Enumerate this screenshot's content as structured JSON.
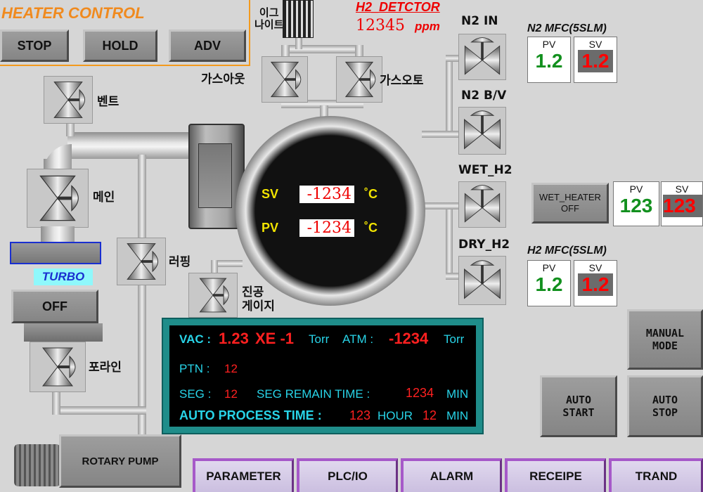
{
  "heater": {
    "title": "HEATER CONTROL",
    "stop": "STOP",
    "hold": "HOLD",
    "adv": "ADV"
  },
  "igniter_label": "이그\n나이트",
  "h2_detector": {
    "title": "H2_DETCTOR",
    "value": "12345",
    "unit": "ppm"
  },
  "valves": {
    "gas_out_left": "가스아웃",
    "gas_out_right": "가스오토",
    "vent": "벤트",
    "main": "메인",
    "roughing": "러핑",
    "vacuum_gauge": "진공\n게이지",
    "foreline": "포라인",
    "n2_in": "N2 IN",
    "n2_bv": "N2 B/V",
    "wet_h2": "WET_H2",
    "dry_h2": "DRY_H2"
  },
  "turbo": {
    "label": "TURBO",
    "state": "OFF"
  },
  "rotary_pump": "ROTARY PUMP",
  "chamber": {
    "sv_label": "SV",
    "sv_value": "-1234",
    "pv_label": "PV",
    "pv_value": "-1234",
    "unit": "˚C"
  },
  "n2_mfc": {
    "title": "N2 MFC(5SLM)",
    "pv_caption": "PV",
    "pv": "1.2",
    "sv_caption": "SV",
    "sv": "1.2"
  },
  "wet_heater": {
    "button": "WET_HEATER\nOFF",
    "pv_caption": "PV",
    "pv": "123",
    "sv_caption": "SV",
    "sv": "123"
  },
  "h2_mfc": {
    "title": "H2 MFC(5SLM)",
    "pv_caption": "PV",
    "pv": "1.2",
    "sv_caption": "SV",
    "sv": "1.2"
  },
  "status": {
    "vac_label": "VAC :",
    "vac_value": "1.23",
    "vac_exp": "XE -1",
    "vac_unit": "Torr",
    "atm_label": "ATM :",
    "atm_value": "-1234",
    "atm_unit": "Torr",
    "ptn_label": "PTN :",
    "ptn_value": "12",
    "seg_label": "SEG :",
    "seg_value": "12",
    "seg_remain_label": "SEG REMAIN TIME :",
    "seg_remain_value": "1234",
    "seg_remain_unit": "MIN",
    "auto_label": "AUTO PROCESS TIME :",
    "auto_hour": "123",
    "auto_hour_unit": "HOUR",
    "auto_min": "12",
    "auto_min_unit": "MIN"
  },
  "buttons": {
    "manual_mode": "MANUAL\nMODE",
    "auto_start": "AUTO\nSTART",
    "auto_stop": "AUTO\nSTOP"
  },
  "nav": [
    "PARAMETER",
    "PLC/IO",
    "ALARM",
    "RECEIPE",
    "TRAND"
  ],
  "colors": {
    "heater_accent": "#f39a1d",
    "nav_border": "#a659c9",
    "alarm_red": "#ff2020",
    "status_cyan": "#28d4e8",
    "pv_green": "#12901e"
  }
}
